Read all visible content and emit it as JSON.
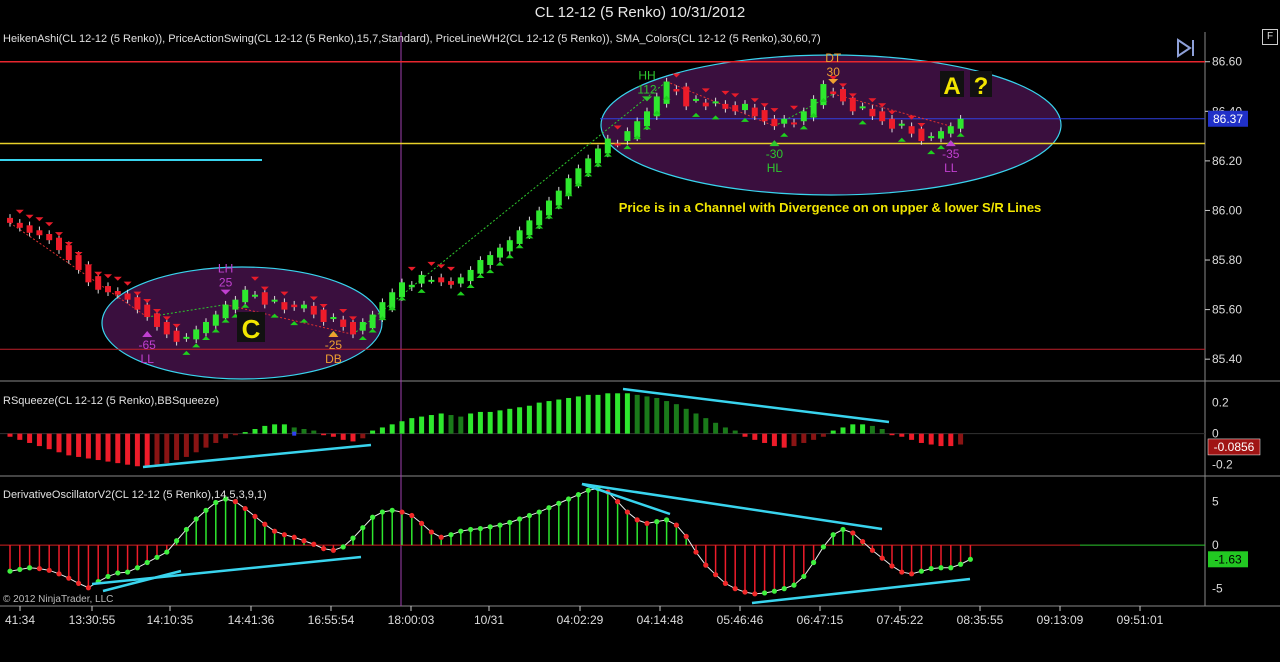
{
  "window": {
    "title": "CL 12-12 (5 Renko)  10/31/2012",
    "f_button": "F"
  },
  "panels": {
    "price": {
      "indicators": "HeikenAshi(CL 12-12 (5 Renko)), PriceActionSwing(CL 12-12 (5 Renko),15,7,Standard), PriceLineWH2(CL 12-12 (5 Renko)), SMA_Colors(CL 12-12 (5 Renko),30,60,7)"
    },
    "squeeze": {
      "indicators": "RSqueeze(CL 12-12 (5 Renko),BBSqueeze)"
    },
    "oscillator": {
      "indicators": "DerivativeOscillatorV2(CL 12-12 (5 Renko),14,5,3,9,1)"
    }
  },
  "copyright": "© 2012 NinjaTrader, LLC",
  "colors": {
    "up": "#2ee82e",
    "down": "#ee1c2a",
    "dark_up": "#1a7a1a",
    "dark_down": "#8a1414",
    "cyan": "#39d4ee",
    "purple_fill": "#3a0f3e",
    "resistance": "#e8262e",
    "support": "#e8d02a"
  },
  "chart_data": [
    {
      "type": "candlestick",
      "series": [
        {
          "name": "HeikenAshi",
          "close": [
            85.95,
            85.93,
            85.91,
            85.9,
            85.88,
            85.84,
            85.8,
            85.76,
            85.71,
            85.68,
            85.67,
            85.66,
            85.64,
            85.6,
            85.57,
            85.53,
            85.5,
            85.47,
            85.49,
            85.52,
            85.55,
            85.58,
            85.62,
            85.64,
            85.68,
            85.66,
            85.62,
            85.64,
            85.6,
            85.61,
            85.62,
            85.58,
            85.55,
            85.57,
            85.53,
            85.5,
            85.55,
            85.58,
            85.63,
            85.67,
            85.71,
            85.7,
            85.74,
            85.72,
            85.71,
            85.7,
            85.73,
            85.76,
            85.8,
            85.82,
            85.85,
            85.88,
            85.92,
            85.96,
            86.0,
            86.04,
            86.08,
            86.13,
            86.17,
            86.21,
            86.25,
            86.29,
            86.27,
            86.32,
            86.36,
            86.4,
            86.46,
            86.52,
            86.48,
            86.42,
            86.45,
            86.42,
            86.44,
            86.41,
            86.4,
            86.43,
            86.38,
            86.36,
            86.34,
            86.37,
            86.35,
            86.4,
            86.45,
            86.51,
            86.47,
            86.44,
            86.4,
            86.42,
            86.38,
            86.36,
            86.33,
            86.35,
            86.31,
            86.28,
            86.3,
            86.32,
            86.34,
            86.37
          ]
        }
      ],
      "y_axis_ticks": [
        "86.60",
        "86.40",
        "86.20",
        "86.00",
        "85.80",
        "85.60",
        "85.40"
      ],
      "ylim": [
        85.32,
        86.72
      ],
      "price_marker": "86.37",
      "horizontal_lines": {
        "resistance": 86.6,
        "support": 86.27,
        "lower": 85.44,
        "blue": 86.37
      },
      "swing_labels": [
        {
          "label": "LH",
          "value": "25"
        },
        {
          "label": "HH",
          "value": "112"
        },
        {
          "label": "DT",
          "value": "30"
        },
        {
          "label": "LL",
          "value": "-65"
        },
        {
          "label": "DB",
          "value": "-25"
        },
        {
          "label": "HL",
          "value": "-30"
        },
        {
          "label": "LL",
          "value": "-35"
        }
      ],
      "annotations": [
        "A",
        "?",
        "C",
        "Price is in a Channel with Divergence on on upper & lower S/R Lines"
      ]
    },
    {
      "type": "bar",
      "title": "RSqueeze",
      "values": [
        -0.02,
        -0.04,
        -0.06,
        -0.08,
        -0.1,
        -0.12,
        -0.14,
        -0.15,
        -0.16,
        -0.17,
        -0.18,
        -0.19,
        -0.2,
        -0.21,
        -0.21,
        -0.2,
        -0.19,
        -0.17,
        -0.15,
        -0.12,
        -0.09,
        -0.06,
        -0.03,
        -0.01,
        0.01,
        0.03,
        0.05,
        0.06,
        0.06,
        0.04,
        0.03,
        0.02,
        -0.01,
        -0.02,
        -0.04,
        -0.05,
        -0.03,
        0.02,
        0.04,
        0.06,
        0.08,
        0.1,
        0.11,
        0.12,
        0.13,
        0.12,
        0.11,
        0.13,
        0.14,
        0.14,
        0.15,
        0.16,
        0.17,
        0.18,
        0.2,
        0.21,
        0.22,
        0.23,
        0.24,
        0.25,
        0.25,
        0.26,
        0.26,
        0.26,
        0.25,
        0.24,
        0.23,
        0.21,
        0.19,
        0.16,
        0.13,
        0.1,
        0.07,
        0.04,
        0.02,
        -0.02,
        -0.04,
        -0.06,
        -0.08,
        -0.09,
        -0.08,
        -0.06,
        -0.04,
        -0.02,
        0.02,
        0.04,
        0.06,
        0.06,
        0.05,
        0.03,
        -0.01,
        -0.02,
        -0.04,
        -0.06,
        -0.07,
        -0.08,
        -0.08,
        -0.07
      ],
      "y_axis_ticks": [
        "0.2",
        "0",
        "-0.2"
      ],
      "ylim": [
        -0.26,
        0.32
      ],
      "value_marker": "-0.0856"
    },
    {
      "type": "bar",
      "title": "DerivativeOscillatorV2",
      "values": [
        -3,
        -2.8,
        -2.6,
        -2.7,
        -2.9,
        -3.3,
        -3.8,
        -4.4,
        -4.9,
        -4.2,
        -3.6,
        -3.2,
        -3.1,
        -2.6,
        -2,
        -1.4,
        -0.8,
        0.5,
        1.8,
        3,
        4,
        4.9,
        5.3,
        5,
        4.2,
        3.3,
        2.4,
        1.6,
        1.2,
        0.9,
        0.5,
        0.1,
        -0.4,
        -0.6,
        -0.2,
        0.8,
        2,
        3.2,
        3.8,
        4,
        3.8,
        3.4,
        2.5,
        1.5,
        0.9,
        1.2,
        1.6,
        1.8,
        1.9,
        2.1,
        2.3,
        2.6,
        3,
        3.4,
        3.8,
        4.3,
        4.8,
        5.3,
        5.8,
        6.3,
        6.5,
        6.1,
        5,
        3.8,
        2.9,
        2.5,
        2.7,
        2.9,
        2.3,
        1,
        -0.8,
        -2.3,
        -3.4,
        -4.4,
        -5,
        -5.4,
        -5.6,
        -5.5,
        -5.3,
        -5,
        -4.6,
        -3.6,
        -2,
        -0.2,
        1.2,
        1.8,
        1.4,
        0.4,
        -0.6,
        -1.5,
        -2.4,
        -3.1,
        -3.3,
        -3,
        -2.7,
        -2.6,
        -2.6,
        -2.2,
        -1.63
      ],
      "y_axis_ticks": [
        "5",
        "0",
        "-5"
      ],
      "ylim": [
        -7,
        7.6
      ],
      "value_marker": "-1.63"
    }
  ],
  "x_axis_ticks": [
    "41:34",
    "13:30:55",
    "14:10:35",
    "14:41:36",
    "16:55:54",
    "18:00:03",
    "10/31",
    "04:02:29",
    "04:14:48",
    "05:46:46",
    "06:47:15",
    "07:45:22",
    "08:35:55",
    "09:13:09",
    "09:51:01"
  ]
}
